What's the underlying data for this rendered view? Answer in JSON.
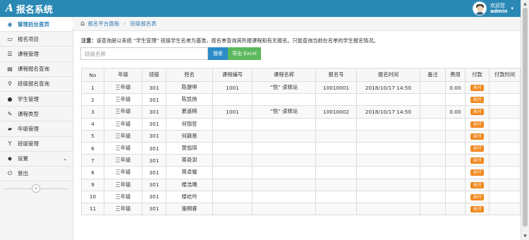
{
  "header": {
    "logo_mark": "A",
    "title": "报名系统",
    "welcome": "欢迎您",
    "username": "admin",
    "caret": "▾"
  },
  "sidebar": {
    "items": [
      {
        "icon": "dashboard-icon",
        "glyph": "◉",
        "label": "管理后台首页",
        "active": true
      },
      {
        "icon": "monitor-icon",
        "glyph": "▭",
        "label": "报名项目"
      },
      {
        "icon": "list-icon",
        "glyph": "☰",
        "label": "课程管理"
      },
      {
        "icon": "chart-icon",
        "glyph": "▤",
        "label": "课程报名查询"
      },
      {
        "icon": "search-icon",
        "glyph": "⚲",
        "label": "班级报名查询"
      },
      {
        "icon": "user-icon",
        "glyph": "●",
        "label": "学生管理"
      },
      {
        "icon": "edit-icon",
        "glyph": "✎",
        "label": "课程类型"
      },
      {
        "icon": "car-icon",
        "glyph": "▰",
        "label": "年级管理"
      },
      {
        "icon": "glass-icon",
        "glyph": "Y",
        "label": "班级管理"
      },
      {
        "icon": "tag-icon",
        "glyph": "◆",
        "label": "设置",
        "chevron": "⌄"
      },
      {
        "icon": "power-icon",
        "glyph": "⏻",
        "label": "登出"
      }
    ],
    "collapse_glyph": "«"
  },
  "breadcrumb": {
    "home_glyph": "⌂",
    "items": [
      "报名平台面板",
      "班级报名表"
    ],
    "separator": "›"
  },
  "notice": {
    "prefix": "注意：",
    "text": "该查询是以系统 “学生管理” 班级学生名单为基准，按名单查询其所报课程和有无报名。只能查询当前在名单的学生报名情况。"
  },
  "search": {
    "placeholder": "班级名称",
    "search_label": "搜索",
    "export_label": "导出 Excel"
  },
  "table": {
    "columns": [
      "No",
      "年级",
      "班级",
      "姓名",
      "课程编号",
      "课程名称",
      "报名号",
      "报名时间",
      "备注",
      "费用",
      "付款",
      "付款时间"
    ],
    "rows": [
      {
        "no": "1",
        "grade": "三年级",
        "class": "301",
        "name": "陈健坤",
        "course_id": "1001",
        "course_name": "“悦” 读驿站",
        "reg_no": "10010001",
        "reg_time": "2018/10/17 14:50",
        "note": "",
        "fee": "0.00",
        "paid": "未付",
        "pay_time": ""
      },
      {
        "no": "2",
        "grade": "三年级",
        "class": "301",
        "name": "陈凯扬",
        "course_id": "",
        "course_name": "",
        "reg_no": "",
        "reg_time": "",
        "note": "",
        "fee": "",
        "paid": "未付",
        "pay_time": ""
      },
      {
        "no": "3",
        "grade": "三年级",
        "class": "301",
        "name": "慕遥棋",
        "course_id": "1001",
        "course_name": "“悦” 读驿站",
        "reg_no": "10010002",
        "reg_time": "2018/10/17 14:50",
        "note": "",
        "fee": "0.00",
        "paid": "未付",
        "pay_time": ""
      },
      {
        "no": "4",
        "grade": "三年级",
        "class": "301",
        "name": "何锦哲",
        "course_id": "",
        "course_name": "",
        "reg_no": "",
        "reg_time": "",
        "note": "",
        "fee": "",
        "paid": "未付",
        "pay_time": ""
      },
      {
        "no": "5",
        "grade": "三年级",
        "class": "301",
        "name": "何籍易",
        "course_id": "",
        "course_name": "",
        "reg_no": "",
        "reg_time": "",
        "note": "",
        "fee": "",
        "paid": "未付",
        "pay_time": ""
      },
      {
        "no": "6",
        "grade": "三年级",
        "class": "301",
        "name": "黄愉琪",
        "course_id": "",
        "course_name": "",
        "reg_no": "",
        "reg_time": "",
        "note": "",
        "fee": "",
        "paid": "未付",
        "pay_time": ""
      },
      {
        "no": "7",
        "grade": "三年级",
        "class": "301",
        "name": "蒋奇澍",
        "course_id": "",
        "course_name": "",
        "reg_no": "",
        "reg_time": "",
        "note": "",
        "fee": "",
        "paid": "未付",
        "pay_time": ""
      },
      {
        "no": "8",
        "grade": "三年级",
        "class": "301",
        "name": "蒋卓耀",
        "course_id": "",
        "course_name": "",
        "reg_no": "",
        "reg_time": "",
        "note": "",
        "fee": "",
        "paid": "未付",
        "pay_time": ""
      },
      {
        "no": "9",
        "grade": "三年级",
        "class": "301",
        "name": "楼浩瑀",
        "course_id": "",
        "course_name": "",
        "reg_no": "",
        "reg_time": "",
        "note": "",
        "fee": "",
        "paid": "未付",
        "pay_time": ""
      },
      {
        "no": "10",
        "grade": "三年级",
        "class": "301",
        "name": "楼屹吟",
        "course_id": "",
        "course_name": "",
        "reg_no": "",
        "reg_time": "",
        "note": "",
        "fee": "",
        "paid": "未付",
        "pay_time": ""
      },
      {
        "no": "11",
        "grade": "三年级",
        "class": "301",
        "name": "骆桐睿",
        "course_id": "",
        "course_name": "",
        "reg_no": "",
        "reg_time": "",
        "note": "",
        "fee": "",
        "paid": "未付",
        "pay_time": ""
      }
    ]
  },
  "scrollbar": {
    "up": "▲",
    "down": "▼"
  },
  "colors": {
    "header_bg": "#2a88b4",
    "active_link": "#2a7db3",
    "search_button": "#2a8bc7",
    "export_button": "#5cb85c",
    "unpaid_badge": "#f0891e"
  }
}
